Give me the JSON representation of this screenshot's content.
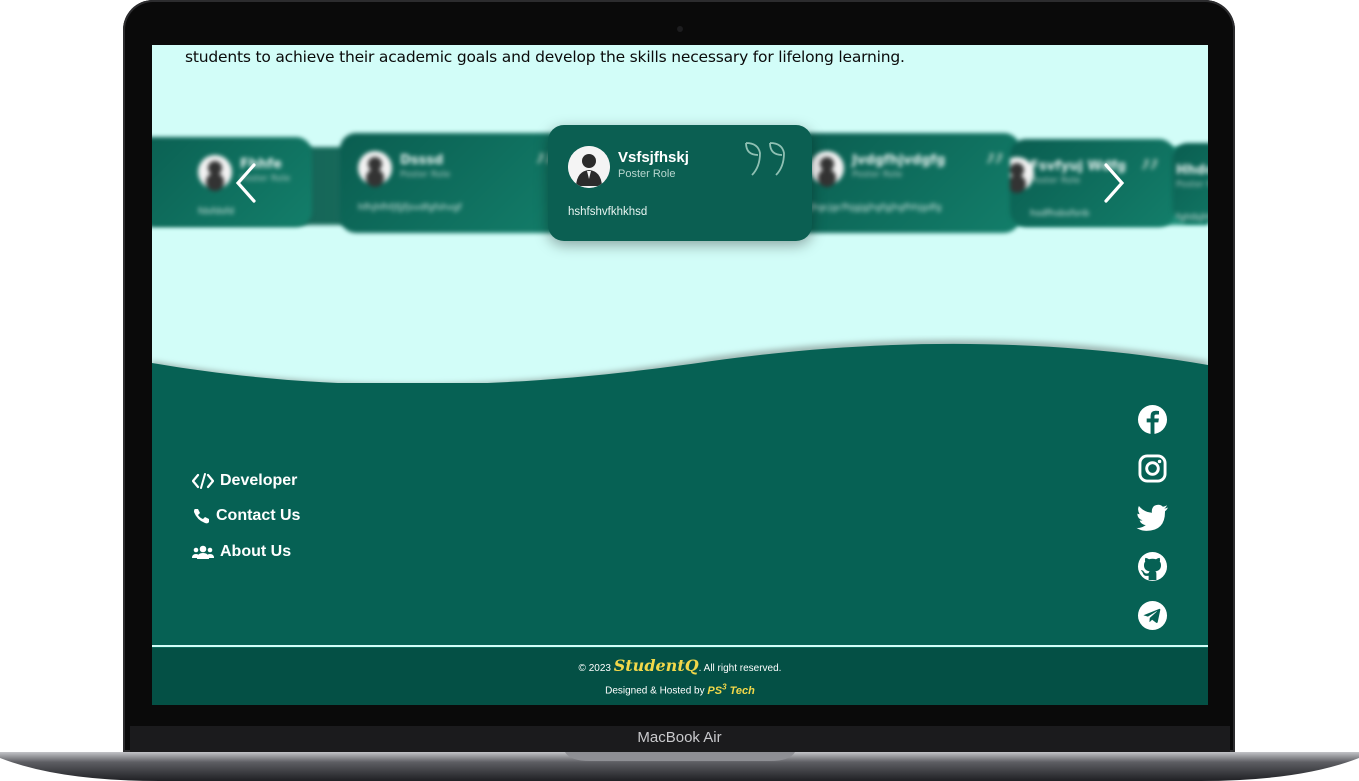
{
  "device": {
    "label": "MacBook Air"
  },
  "intro": {
    "text": "students to achieve their academic goals and develop the skills necessary for lifelong learning."
  },
  "testimonials": {
    "main": {
      "name": "Vsfsjfhskj",
      "role": "Poster Role",
      "text": "hshfshvfkhkhsd"
    },
    "side": [
      {
        "name": "Fhhfe",
        "role": "Poster Role",
        "text": "fdsfdsfd"
      },
      {
        "name": "Dsssd",
        "role": "Poster Role",
        "text": "hfhjhfhfjfjjfjsvdfgfshvgf"
      },
      {
        "name": "Jvdgfhjvdgfg",
        "role": "Poster Role",
        "text": "jhgcjgcfhjgjgjhgfgjhgfhhjgdfg"
      },
      {
        "name": "Fsvfyuj Wdfg",
        "role": "Poster Role",
        "text": "hsdfhsbsfsnb"
      },
      {
        "name": "Hhdc",
        "role": "Poster Role",
        "text": "fghtbjhf"
      }
    ]
  },
  "footer": {
    "links": [
      {
        "label": "Developer",
        "icon": "code-icon"
      },
      {
        "label": "Contact Us",
        "icon": "phone-icon"
      },
      {
        "label": "About Us",
        "icon": "users-icon"
      }
    ],
    "socials": [
      "facebook-icon",
      "instagram-icon",
      "twitter-icon",
      "github-icon",
      "telegram-icon"
    ],
    "copyright_prefix": "© 2023",
    "brand": "StudentQ",
    "copyright_suffix": ". All right reserved.",
    "hosted_prefix": "Designed & Hosted by",
    "host_brand": "PS",
    "host_brand_sup": "3",
    "host_brand_suffix": "Tech"
  },
  "colors": {
    "screen_bg": "#d2fdf8",
    "footer_bg": "#066154",
    "bottom_bar": "#045045",
    "accent_yellow": "#f2d84a"
  }
}
